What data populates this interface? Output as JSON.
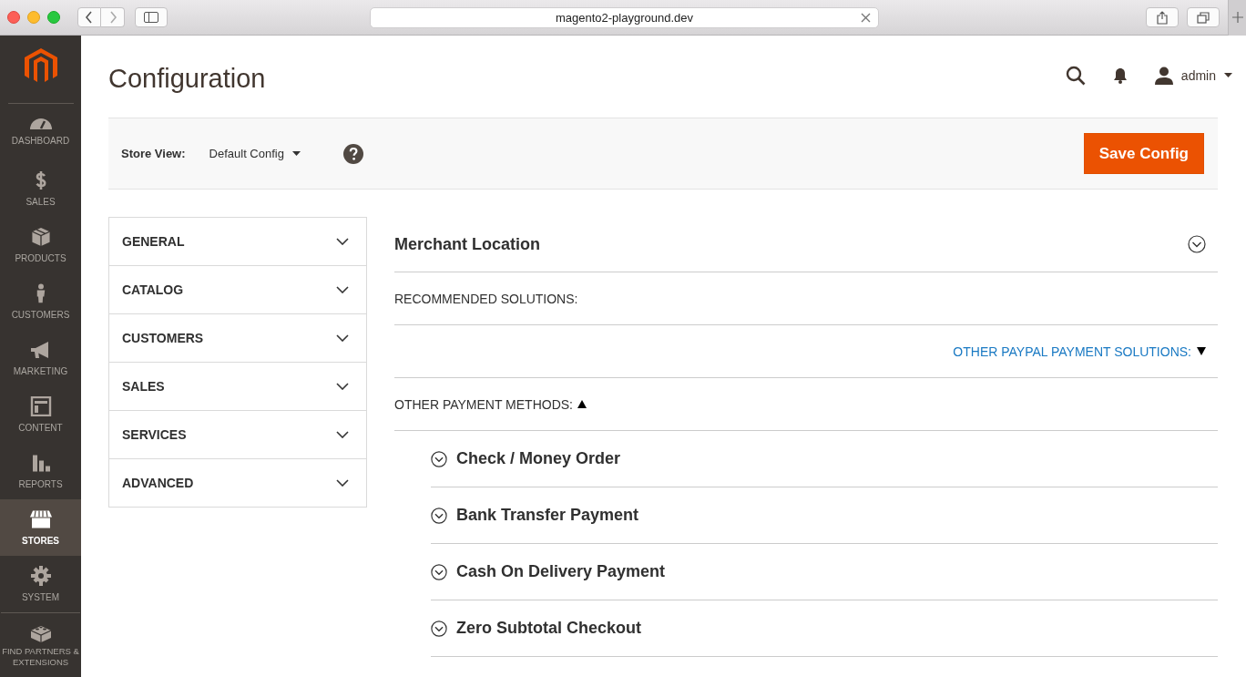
{
  "browser": {
    "url": "magento2-playground.dev"
  },
  "sidebar": {
    "items": [
      {
        "label": "DASHBOARD",
        "selected": false
      },
      {
        "label": "SALES",
        "selected": false
      },
      {
        "label": "PRODUCTS",
        "selected": false
      },
      {
        "label": "CUSTOMERS",
        "selected": false
      },
      {
        "label": "MARKETING",
        "selected": false
      },
      {
        "label": "CONTENT",
        "selected": false
      },
      {
        "label": "REPORTS",
        "selected": false
      },
      {
        "label": "STORES",
        "selected": true
      },
      {
        "label": "SYSTEM",
        "selected": false
      },
      {
        "label": "FIND PARTNERS & EXTENSIONS",
        "selected": false
      }
    ]
  },
  "header": {
    "title": "Configuration",
    "user": "admin"
  },
  "toolbar": {
    "store_view_label": "Store View:",
    "store_view_value": "Default Config",
    "save_button": "Save Config"
  },
  "config_tabs": [
    {
      "label": "GENERAL",
      "expanded": false
    },
    {
      "label": "CATALOG",
      "expanded": false
    },
    {
      "label": "CUSTOMERS",
      "expanded": false
    },
    {
      "label": "SALES",
      "expanded": false
    },
    {
      "label": "SERVICES",
      "expanded": false
    },
    {
      "label": "ADVANCED",
      "expanded": false
    }
  ],
  "section": {
    "title": "Merchant Location",
    "expanded": false,
    "rows": [
      {
        "kind": "heading",
        "label": "RECOMMENDED SOLUTIONS:"
      },
      {
        "kind": "link",
        "label": "OTHER PAYPAL PAYMENT SOLUTIONS:",
        "expanded": false
      },
      {
        "kind": "toggle",
        "label": "OTHER PAYMENT METHODS:",
        "expanded": true
      }
    ],
    "methods": [
      {
        "label": "Check / Money Order",
        "expanded": false
      },
      {
        "label": "Bank Transfer Payment",
        "expanded": false
      },
      {
        "label": "Cash On Delivery Payment",
        "expanded": false
      },
      {
        "label": "Zero Subtotal Checkout",
        "expanded": false
      }
    ]
  }
}
